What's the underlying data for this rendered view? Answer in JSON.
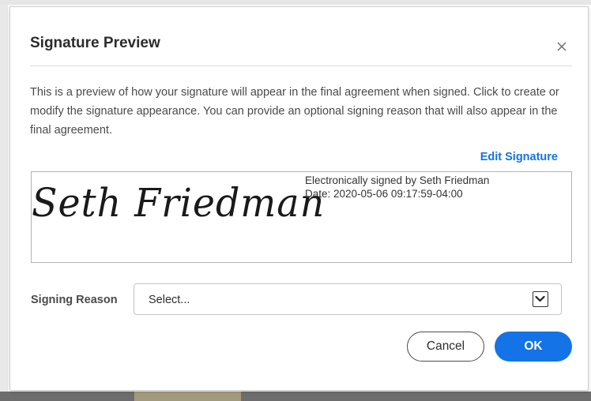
{
  "dialog": {
    "title": "Signature Preview",
    "close_icon": "close-icon",
    "description": "This is a preview of how your signature will appear in the final agreement when signed. Click to create or modify the signature appearance. You can provide an optional signing reason that will also appear in the final agreement.",
    "edit_signature_label": "Edit Signature",
    "signature": {
      "name": "Seth Friedman",
      "signed_by_line": "Electronically signed by Seth Friedman",
      "date_line": "Date: 2020-05-06 09:17:59-04:00"
    },
    "signing_reason": {
      "label": "Signing Reason",
      "selected_value": "Select...",
      "arrow_icon": "chevron-down-icon"
    },
    "buttons": {
      "cancel_label": "Cancel",
      "ok_label": "OK"
    }
  },
  "colors": {
    "accent": "#1473e6",
    "text": "#2c2c2c",
    "border": "#b3b3b3"
  }
}
